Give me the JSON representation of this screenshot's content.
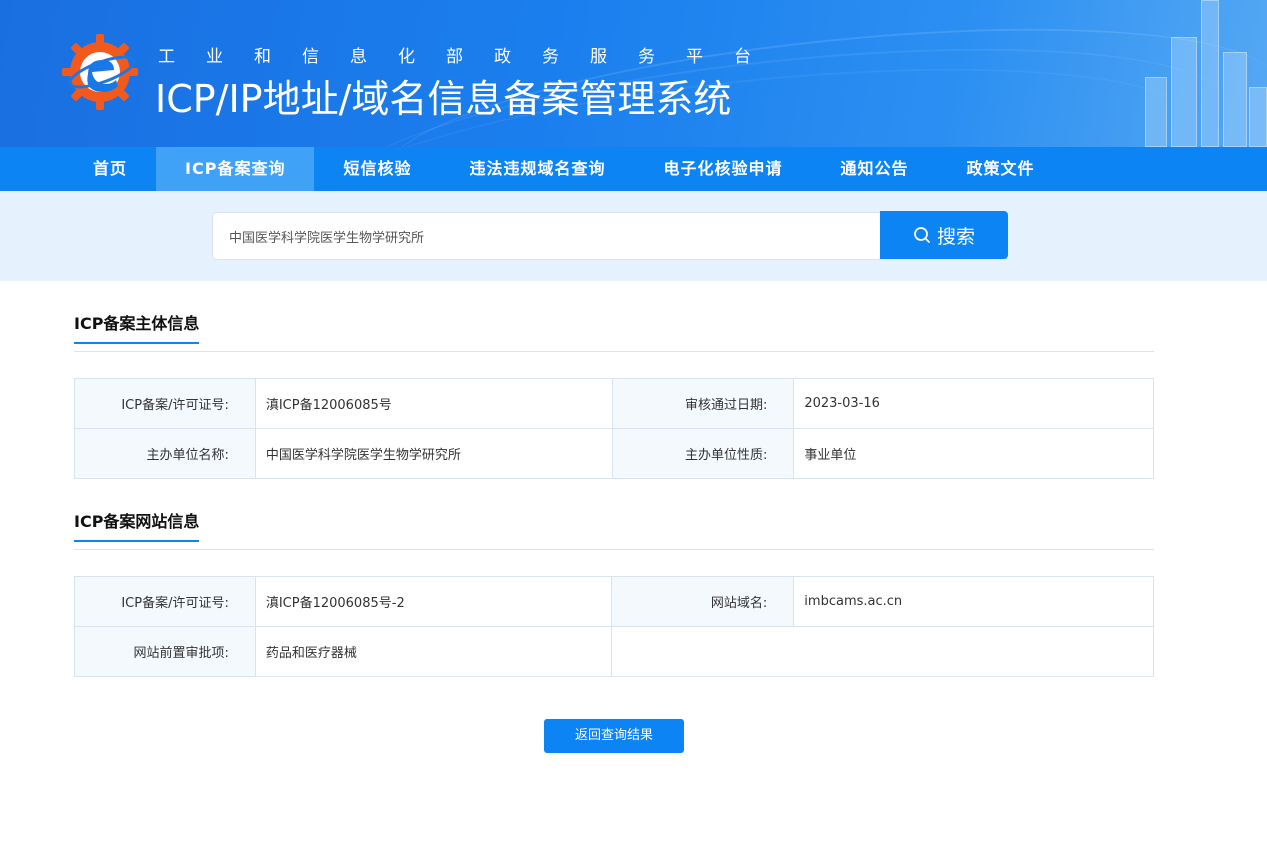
{
  "header": {
    "subtitle": "工业和信息化部政务服务平台",
    "title": "ICP/IP地址/域名信息备案管理系统"
  },
  "nav": {
    "items": [
      {
        "label": "首页"
      },
      {
        "label": "ICP备案查询",
        "active": true
      },
      {
        "label": "短信核验"
      },
      {
        "label": "违法违规域名查询"
      },
      {
        "label": "电子化核验申请"
      },
      {
        "label": "通知公告"
      },
      {
        "label": "政策文件"
      }
    ]
  },
  "search": {
    "value": "中国医学科学院医学生物学研究所",
    "button_label": "搜索"
  },
  "subject_section": {
    "title": "ICP备案主体信息",
    "license_label": "ICP备案/许可证号:",
    "license_value": "滇ICP备12006085号",
    "approve_date_label": "审核通过日期:",
    "approve_date_value": "2023-03-16",
    "org_name_label": "主办单位名称:",
    "org_name_value": "中国医学科学院医学生物学研究所",
    "org_type_label": "主办单位性质:",
    "org_type_value": "事业单位"
  },
  "website_section": {
    "title": "ICP备案网站信息",
    "license_label": "ICP备案/许可证号:",
    "license_value": "滇ICP备12006085号-2",
    "domain_label": "网站域名:",
    "domain_value": "imbcams.ac.cn",
    "pre_approval_label": "网站前置审批项:",
    "pre_approval_value": "药品和医疗器械"
  },
  "back_button_label": "返回查询结果",
  "colors": {
    "primary": "#0d84f3",
    "nav_active": "#3fa2f7",
    "search_bg": "#e5f1fd",
    "logo_orange": "#f25a1d"
  }
}
